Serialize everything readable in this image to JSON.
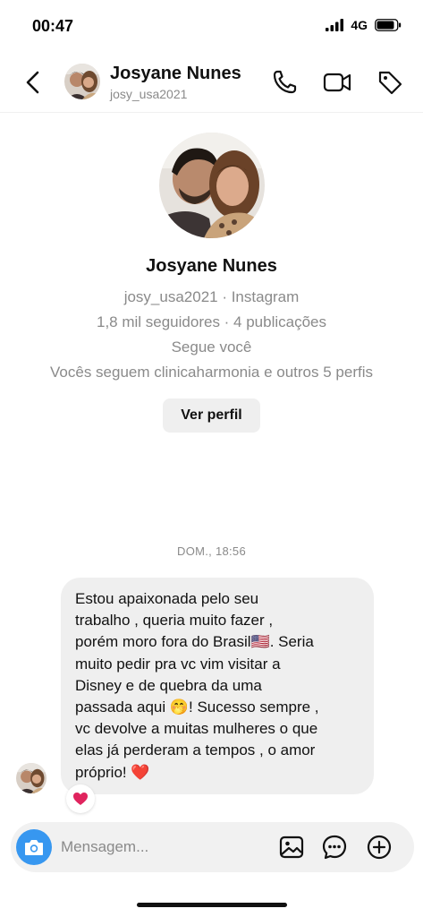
{
  "status_bar": {
    "time": "00:47",
    "network": "4G"
  },
  "header": {
    "name": "Josyane Nunes",
    "username": "josy_usa2021"
  },
  "profile": {
    "name": "Josyane Nunes",
    "handle_line": "josy_usa2021 · Instagram",
    "stats_line": "1,8 mil seguidores · 4 publicações",
    "follows_you": "Segue você",
    "mutuals": "Vocês seguem clinicaharmonia e outros 5 perfis",
    "view_profile_label": "Ver perfil"
  },
  "thread": {
    "date_label": "DOM., 18:56",
    "messages": [
      {
        "lines": [
          "Estou apaixonada pelo seu",
          "trabalho , queria muito fazer ,",
          "porém moro fora do Brasil🇺🇸. Seria",
          "muito pedir pra vc vim visitar a",
          "Disney e de quebra da uma",
          "passada aqui 🤭! Sucesso sempre ,",
          "vc devolve a muitas mulheres o que",
          "elas já perderam a tempos , o amor",
          "próprio! ❤️"
        ],
        "reaction": "❤️"
      }
    ]
  },
  "composer": {
    "placeholder": "Mensagem..."
  },
  "icons": {
    "back": "chevron-left-icon",
    "call": "phone-icon",
    "video": "video-camera-icon",
    "tag": "tag-icon",
    "camera": "camera-icon",
    "gallery": "image-icon",
    "sticker": "chat-bubble-icon",
    "add": "plus-circle-icon"
  },
  "colors": {
    "accent": "#3797f0",
    "bubble": "#efefef",
    "secondary_text": "#8a8a8a",
    "heart": "#e0245e"
  }
}
